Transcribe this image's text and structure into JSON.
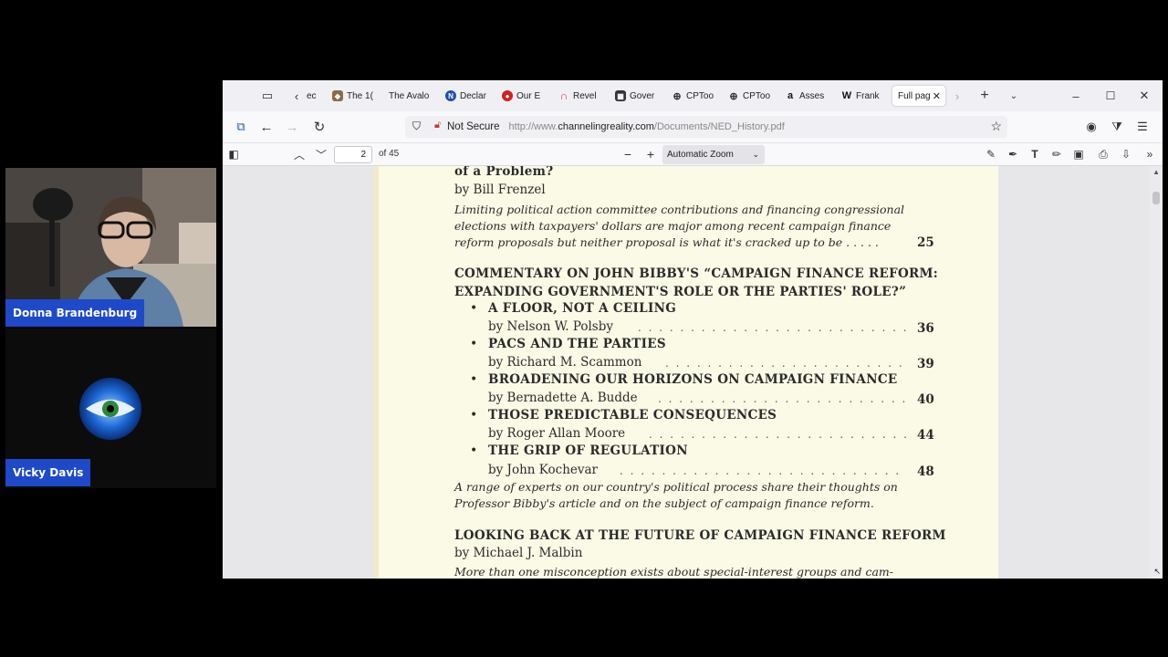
{
  "participants": [
    {
      "name": "Donna Brandenburg"
    },
    {
      "name": "Vicky Davis"
    }
  ],
  "tabs": [
    {
      "label": "ec",
      "icon": "page-icon"
    },
    {
      "label": "The 1(",
      "icon": "bookmark-icon"
    },
    {
      "label": "The Avalo",
      "icon": "none"
    },
    {
      "label": "Declar",
      "icon": "n-logo-icon"
    },
    {
      "label": "Our E",
      "icon": "red-logo-icon"
    },
    {
      "label": "Revel",
      "icon": "red-arc-icon"
    },
    {
      "label": "Gover",
      "icon": "building-icon"
    },
    {
      "label": "CPToo",
      "icon": "globe-icon"
    },
    {
      "label": "CPToo",
      "icon": "globe-icon"
    },
    {
      "label": "Asses",
      "icon": "amazon-icon"
    },
    {
      "label": "Frank",
      "icon": "wikipedia-icon"
    },
    {
      "label": "Full pag",
      "icon": "none",
      "active": true
    }
  ],
  "nav": {
    "security_label": "Not Secure",
    "url_prefix": "http://www.",
    "url_domain": "channelingreality.com",
    "url_path": "/Documents/NED_History.pdf"
  },
  "pdf_toolbar": {
    "page_number": "2",
    "page_of": "of 45",
    "zoom": "Automatic Zoom"
  },
  "document": {
    "top_title_fragment": "of a Problem?",
    "top_author": "by Bill Frenzel",
    "top_desc": [
      "Limiting political action committee contributions and financing congressional",
      "elections with taxpayers' dollars are major among recent campaign finance",
      "reform proposals but neither proposal is what it's cracked up to be . . . . ."
    ],
    "top_page": "25",
    "commentary_heading": [
      "COMMENTARY ON JOHN BIBBY'S “CAMPAIGN FINANCE REFORM:",
      "EXPANDING GOVERNMENT'S ROLE OR THE PARTIES' ROLE?”"
    ],
    "entries": [
      {
        "title": "A FLOOR, NOT A CEILING",
        "author": "by Nelson W. Polsby",
        "page": "36"
      },
      {
        "title": "PACS AND THE PARTIES",
        "author": "by Richard M. Scammon",
        "page": "39"
      },
      {
        "title": "BROADENING OUR HORIZONS ON CAMPAIGN FINANCE",
        "author": "by Bernadette A. Budde",
        "page": "40"
      },
      {
        "title": "THOSE PREDICTABLE CONSEQUENCES",
        "author": "by Roger Allan Moore",
        "page": "44"
      },
      {
        "title": "THE GRIP OF REGULATION",
        "author": "by John Kochevar",
        "page": "48"
      }
    ],
    "commentary_desc": [
      "A range of experts on our country's political process share their thoughts on",
      "Professor Bibby's article and on the subject of campaign finance reform."
    ],
    "last_heading": "LOOKING BACK AT THE FUTURE OF CAMPAIGN FINANCE REFORM",
    "last_author": "by Michael J. Malbin",
    "last_desc": "More than one misconception exists about special-interest groups and cam-"
  }
}
